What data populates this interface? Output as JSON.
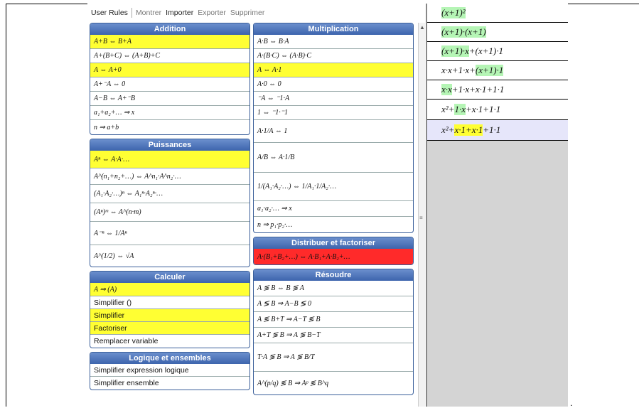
{
  "toolbar": {
    "user_rules": "User Rules",
    "show": "Montrer",
    "import": "Importer",
    "export": "Exporter",
    "delete": "Supprimer"
  },
  "left_panels": [
    {
      "title": "Addition",
      "rows": [
        {
          "text": "A+B ⇔ B+A",
          "hl": true
        },
        {
          "text": "A+(B+C) ⇔ (A+B)+C",
          "hl": false
        },
        {
          "text": "A ⇔ A+0",
          "hl": true
        },
        {
          "text": "A+⁻A ⇔ 0",
          "hl": false
        },
        {
          "text": "A−B ⇔ A+⁻B",
          "hl": false
        },
        {
          "text": "a₁+a₂+… ⇒ x",
          "hl": false
        },
        {
          "text": "n ⇒ a+b",
          "hl": false
        }
      ]
    },
    {
      "title": "Puissances",
      "rows": [
        {
          "text": "Aⁿ ⇔ A·A·…",
          "hl": true
        },
        {
          "text": "A^(n₁+n₂+…) ⇔ A^n₁·A^n₂·…",
          "hl": false
        },
        {
          "text": "(A₁·A₂·…)ⁿ ⇔ A₁ⁿ·A₂ⁿ·…",
          "hl": false
        },
        {
          "text": "(Aⁿ)ᵐ ⇔ A^(n·m)",
          "hl": false
        },
        {
          "text": "A⁻ⁿ ⇔ 1/Aⁿ",
          "hl": false
        },
        {
          "text": "A^(1/2) ⇔ √A",
          "hl": false
        }
      ]
    },
    {
      "title": "Calculer",
      "rows": [
        {
          "text": "A ⇒ (A)",
          "hl": true,
          "plain": false
        },
        {
          "text": "Simplifier ()",
          "hl": false,
          "plain": true
        },
        {
          "text": "Simplifier",
          "hl": true,
          "plain": true
        },
        {
          "text": "Factoriser",
          "hl": true,
          "plain": true
        },
        {
          "text": "Remplacer variable",
          "hl": false,
          "plain": true
        }
      ]
    },
    {
      "title": "Logique et ensembles",
      "rows": [
        {
          "text": "Simplifier expression logique",
          "hl": false,
          "plain": true
        },
        {
          "text": "Simplifier ensemble",
          "hl": false,
          "plain": true
        }
      ]
    }
  ],
  "right_panels": [
    {
      "title": "Multiplication",
      "rows": [
        {
          "text": "A·B ⇔ B·A",
          "hl": false
        },
        {
          "text": "A·(B·C) ⇔ (A·B)·C",
          "hl": false
        },
        {
          "text": "A ⇔ A·1",
          "hl": true
        },
        {
          "text": "A·0 ⇔ 0",
          "hl": false
        },
        {
          "text": "⁻A ⇔ ⁻1·A",
          "hl": false
        },
        {
          "text": "1 ⇔ ⁻1·⁻1",
          "hl": false
        },
        {
          "text": "A·1/A ⇔ 1",
          "hl": false
        },
        {
          "text": "A/B ⇔ A·1/B",
          "hl": false
        },
        {
          "text": "1/(A₁·A₂·…) ⇔ 1/A₁·1/A₂·…",
          "hl": false
        },
        {
          "text": "a₁·a₂·… ⇒ x",
          "hl": false
        },
        {
          "text": "n ⇒ p₁·p₂·…",
          "hl": false
        }
      ]
    },
    {
      "title": "Distribuer et factoriser",
      "rows": [
        {
          "text": "A·(B₁+B₂+…) ⇔ A·B₁+A·B₂+…",
          "red": true
        }
      ]
    },
    {
      "title": "Résoudre",
      "rows": [
        {
          "text": "A ≶ B ⇔ B ≶ A",
          "hl": false
        },
        {
          "text": "A ≶ B ⇒ A−B ≶ 0",
          "hl": false
        },
        {
          "text": "A ≶ B+T ⇒ A−T ≶ B",
          "hl": false
        },
        {
          "text": "A+T ≶ B ⇒ A ≶ B−T",
          "hl": false
        },
        {
          "text": "T·A ≶ B ⇒ A ≶ B/T",
          "hl": false
        },
        {
          "text": "A^(p/q) ≶ B ⇒ Aᵖ ≶ B^q",
          "hl": false
        }
      ]
    }
  ],
  "steps": [
    {
      "pre": "(x+1)²",
      "mid": "",
      "post": "",
      "hl": "green-all"
    },
    {
      "pre": "",
      "mid": "(x+1)·(x+1)",
      "post": "",
      "hl": "green"
    },
    {
      "pre": "",
      "mid": "(x+1)·x",
      "post": "+(x+1)·1",
      "hl": "green"
    },
    {
      "pre": "x·x+1·x+",
      "mid": "(x+1)·1",
      "post": "",
      "hl": "green"
    },
    {
      "pre": "",
      "mid": "x·x",
      "post": "+1·x+x·1+1·1",
      "hl": "green"
    },
    {
      "pre": "x²+",
      "mid": "1·x",
      "post": "+x·1+1·1",
      "hl": "green"
    },
    {
      "pre": "x²+",
      "mid": "x·1+x·1",
      "post": "+1·1",
      "hl": "yellow"
    }
  ],
  "colors": {
    "header_blue": "#3d64ad",
    "rule_yellow": "#ffff33",
    "rule_red": "#ff2a2a",
    "step_green": "#b5f5b5",
    "step_selected": "#e6e6fa"
  }
}
